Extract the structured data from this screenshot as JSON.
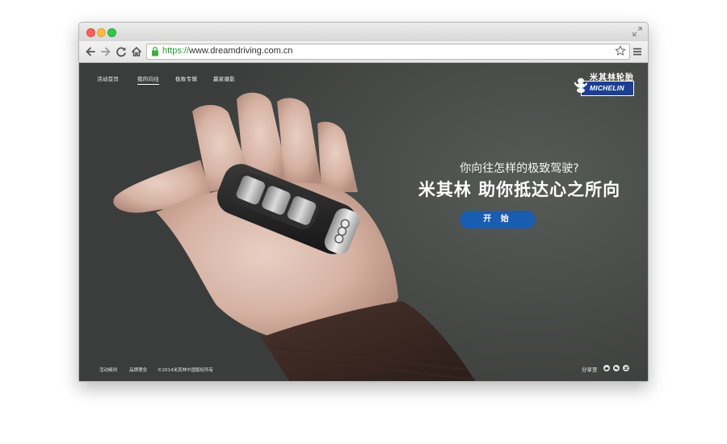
{
  "browser": {
    "url_scheme": "https://",
    "url_rest": "www.dreamdriving.com.cn",
    "traffic_lights": {
      "close": "#fc605c",
      "minimize": "#fdbc40",
      "zoom": "#34c84a"
    },
    "icons": [
      "back-icon",
      "forward-icon",
      "reload-icon",
      "home-icon",
      "lock-icon",
      "star-icon",
      "menu-icon",
      "expand-icon"
    ]
  },
  "site": {
    "nav": [
      "活动首页",
      "我的向往",
      "极致专辑",
      "赢家摄影"
    ],
    "active_nav_index": 1,
    "brand_cn": "米其林轮胎",
    "brand_logo": "MICHELIN",
    "question": "你向往怎样的极致驾驶?",
    "slogan": "米其林 助你抵达心之所向",
    "start_button": "开 始",
    "accent_color": "#1a5cb0",
    "footer": {
      "rules": "活动细则",
      "brand": "品牌理念",
      "copyright": "©2014米其林中国版权所有"
    },
    "share_label": "分享至",
    "share_icons": [
      "weibo-icon",
      "wechat-icon",
      "qzone-icon"
    ]
  }
}
